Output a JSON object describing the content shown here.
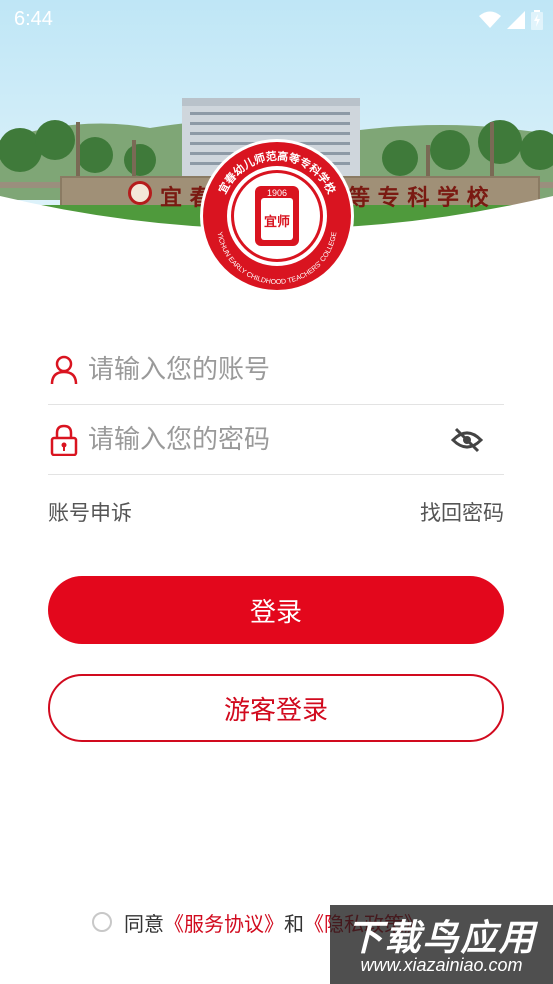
{
  "status_bar": {
    "time": "6:44"
  },
  "school": {
    "emblem_year": "1906",
    "emblem_chinese": "宜春幼儿师范高等专科学校",
    "emblem_english": "YICHUN EARLY CHILDHOOD TEACHERS' COLLEGE",
    "emblem_center": "宜师",
    "sign_left": "宜 春",
    "sign_right": "等 专 科 学 校"
  },
  "form": {
    "account_placeholder": "请输入您的账号",
    "password_placeholder": "请输入您的密码"
  },
  "links": {
    "appeal": "账号申诉",
    "recover": "找回密码"
  },
  "buttons": {
    "login": "登录",
    "guest": "游客登录"
  },
  "agreement": {
    "agree_label": "同意",
    "service_terms": "《服务协议》",
    "and": "和",
    "privacy_policy": "《隐私政策》"
  },
  "watermark": {
    "title": "下载鸟应用",
    "url": "www.xiazainiao.com"
  },
  "colors": {
    "brand_red": "#e3071c",
    "link_red": "#d10a1e"
  },
  "icons": [
    "wifi-icon",
    "signal-icon",
    "battery-icon",
    "user-icon",
    "lock-icon",
    "eye-off-icon",
    "radio-unchecked-icon"
  ]
}
